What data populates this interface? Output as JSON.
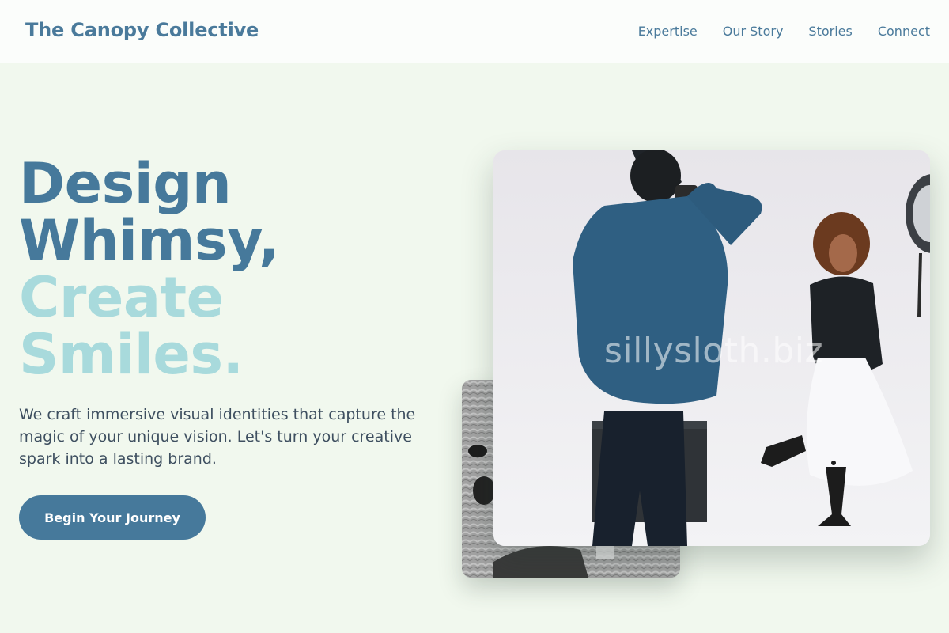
{
  "header": {
    "brand": "The Canopy Collective",
    "nav": [
      "Expertise",
      "Our Story",
      "Stories",
      "Connect"
    ]
  },
  "hero": {
    "title_line1": "Design",
    "title_line2": "Whimsy,",
    "title_line3": "Create",
    "title_line4": "Smiles.",
    "description": "We craft immersive visual identities that capture the magic of your unique vision. Let's turn your creative spark into a lasting brand.",
    "cta_label": "Begin Your Journey"
  },
  "media": {
    "main_photo_watermark": "sillysloth.biz"
  },
  "colors": {
    "primary": "#46799b",
    "accent": "#a8dadc",
    "background": "#f1f8ee"
  }
}
